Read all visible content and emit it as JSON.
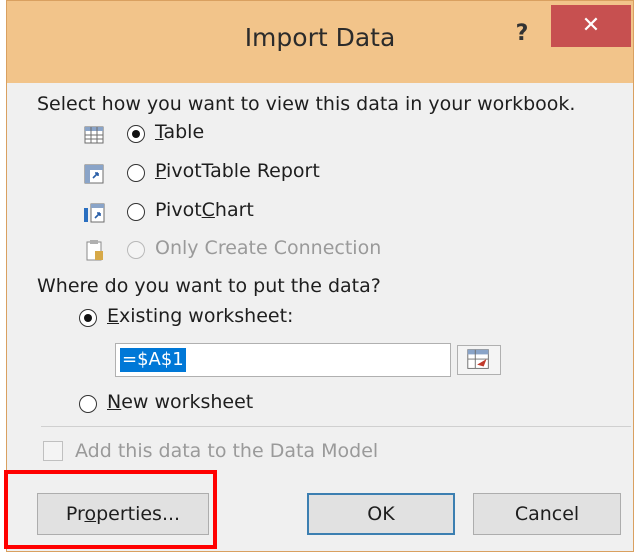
{
  "dialog": {
    "title": "Import Data",
    "help_label": "?",
    "close_label": "✕"
  },
  "view": {
    "heading": "Select how you want to view this data in your workbook.",
    "options": [
      {
        "label_pre": "",
        "mnemonic": "T",
        "label_post": "able",
        "selected": true,
        "enabled": true,
        "icon": "table-icon"
      },
      {
        "label_pre": "",
        "mnemonic": "P",
        "label_post": "ivotTable Report",
        "selected": false,
        "enabled": true,
        "icon": "pivottable-icon"
      },
      {
        "label_pre": "Pivot",
        "mnemonic": "C",
        "label_post": "hart",
        "selected": false,
        "enabled": true,
        "icon": "pivotchart-icon"
      },
      {
        "label_pre": "Only Create Connection",
        "mnemonic": "",
        "label_post": "",
        "selected": false,
        "enabled": false,
        "icon": "connection-icon"
      }
    ]
  },
  "location": {
    "heading": "Where do you want to put the data?",
    "existing_pre": "",
    "existing_mnemonic": "E",
    "existing_post": "xisting worksheet:",
    "existing_selected": true,
    "range_value": "=$A$1",
    "new_pre": "",
    "new_mnemonic": "N",
    "new_post": "ew worksheet",
    "new_selected": false
  },
  "data_model": {
    "label": "Add this data to the Data Model",
    "checked": false,
    "enabled": false
  },
  "buttons": {
    "properties_pre": "Pr",
    "properties_mnemonic": "o",
    "properties_post": "perties...",
    "ok_label": "OK",
    "cancel_label": "Cancel"
  },
  "colors": {
    "titlebar": "#f2c48a",
    "close": "#c75050",
    "highlight": "#ff0000",
    "selection": "#0078d7"
  }
}
